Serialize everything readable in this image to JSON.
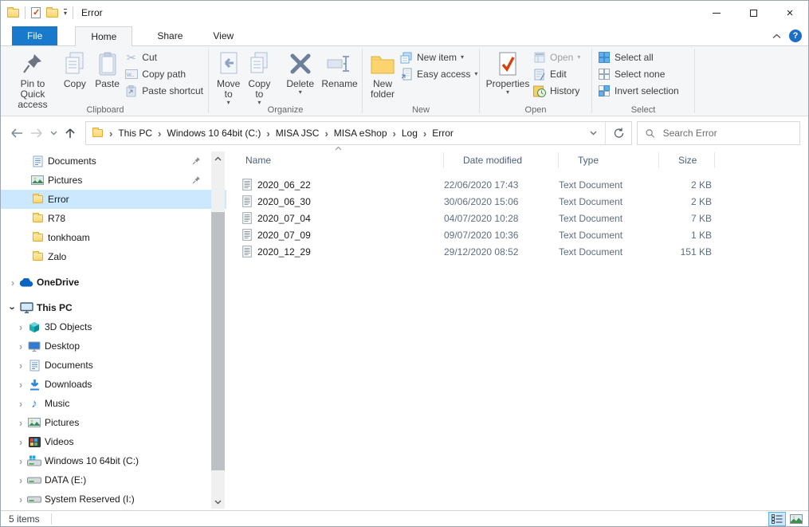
{
  "window": {
    "title": "Error"
  },
  "tabs": {
    "file": "File",
    "home": "Home",
    "share": "Share",
    "view": "View"
  },
  "ribbon": {
    "clipboard": {
      "label": "Clipboard",
      "pin": "Pin to Quick access",
      "copy": "Copy",
      "paste": "Paste",
      "cut": "Cut",
      "copy_path": "Copy path",
      "paste_shortcut": "Paste shortcut"
    },
    "organize": {
      "label": "Organize",
      "move_to": "Move to",
      "copy_to": "Copy to",
      "delete": "Delete",
      "rename": "Rename"
    },
    "new_group": {
      "label": "New",
      "new_folder": "New folder",
      "new_item": "New item",
      "easy_access": "Easy access"
    },
    "open_group": {
      "label": "Open",
      "properties": "Properties",
      "open": "Open",
      "edit": "Edit",
      "history": "History"
    },
    "select_group": {
      "label": "Select",
      "select_all": "Select all",
      "select_none": "Select none",
      "invert": "Invert selection"
    }
  },
  "address": {
    "crumbs": [
      "This PC",
      "Windows 10 64bit (C:)",
      "MISA JSC",
      "MISA eShop",
      "Log",
      "Error"
    ],
    "search_placeholder": "Search Error"
  },
  "sidebar": {
    "items": [
      {
        "label": "Documents"
      },
      {
        "label": "Pictures"
      },
      {
        "label": "Error"
      },
      {
        "label": "R78"
      },
      {
        "label": "tonkhoam"
      },
      {
        "label": "Zalo"
      },
      {
        "label": "OneDrive"
      },
      {
        "label": "This PC"
      },
      {
        "label": "3D Objects"
      },
      {
        "label": "Desktop"
      },
      {
        "label": "Documents"
      },
      {
        "label": "Downloads"
      },
      {
        "label": "Music"
      },
      {
        "label": "Pictures"
      },
      {
        "label": "Videos"
      },
      {
        "label": "Windows 10 64bit (C:)"
      },
      {
        "label": "DATA (E:)"
      },
      {
        "label": "System Reserved (I:)"
      }
    ]
  },
  "filelist": {
    "columns": [
      "Name",
      "Date modified",
      "Type",
      "Size"
    ],
    "rows": [
      {
        "name": "2020_06_22",
        "modified": "22/06/2020 17:43",
        "type": "Text Document",
        "size": "2 KB"
      },
      {
        "name": "2020_06_30",
        "modified": "30/06/2020 15:06",
        "type": "Text Document",
        "size": "2 KB"
      },
      {
        "name": "2020_07_04",
        "modified": "04/07/2020 10:28",
        "type": "Text Document",
        "size": "7 KB"
      },
      {
        "name": "2020_07_09",
        "modified": "09/07/2020 10:36",
        "type": "Text Document",
        "size": "1 KB"
      },
      {
        "name": "2020_12_29",
        "modified": "29/12/2020 08:52",
        "type": "Text Document",
        "size": "151 KB"
      }
    ]
  },
  "status": {
    "items_text": "5 items"
  },
  "colors": {
    "accent_blue": "#1979ca",
    "selection": "#cce8ff",
    "folder_yellow": "#fbd46f"
  }
}
